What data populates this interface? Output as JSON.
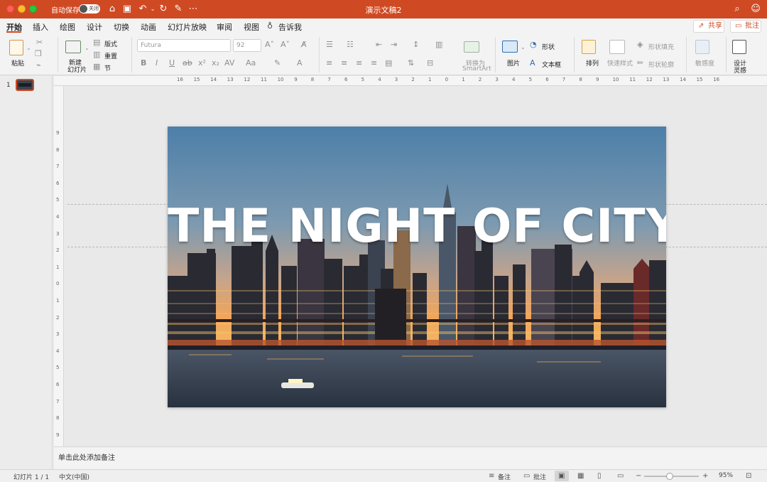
{
  "window": {
    "title": "演示文稿2",
    "autosave_label": "自动保存",
    "autosave_state": "关闭"
  },
  "tabs": [
    "开始",
    "插入",
    "绘图",
    "设计",
    "切换",
    "动画",
    "幻灯片放映",
    "审阅",
    "视图",
    "告诉我"
  ],
  "header_buttons": {
    "share": "共享",
    "comment": "批注"
  },
  "ribbon": {
    "paste": "粘贴",
    "new_slide_line1": "新建",
    "new_slide_line2": "幻灯片",
    "layout": "版式",
    "reset": "重置",
    "section": "节",
    "font_name": "Futura",
    "font_size": "92",
    "convert_smartart_line1": "转换为",
    "convert_smartart_line2": "SmartArt",
    "picture": "图片",
    "shape": "形状",
    "textbox": "文本框",
    "arrange": "排列",
    "quick_styles": "快速样式",
    "shape_fill": "形状填充",
    "shape_outline": "形状轮廓",
    "sensitivity": "敏感度",
    "designer_line1": "设计",
    "designer_line2": "灵感"
  },
  "thumbnail": {
    "number": "1"
  },
  "hruler_ticks": [
    "16",
    "15",
    "14",
    "13",
    "12",
    "11",
    "10",
    "9",
    "8",
    "7",
    "6",
    "5",
    "4",
    "3",
    "2",
    "1",
    "0",
    "1",
    "2",
    "3",
    "4",
    "5",
    "6",
    "7",
    "8",
    "9",
    "10",
    "11",
    "12",
    "13",
    "14",
    "15",
    "16"
  ],
  "vruler_ticks": [
    "9",
    "8",
    "7",
    "6",
    "5",
    "4",
    "3",
    "2",
    "1",
    "0",
    "1",
    "2",
    "3",
    "4",
    "5",
    "6",
    "7",
    "8",
    "9"
  ],
  "slide": {
    "title": "THE NIGHT OF CITY"
  },
  "notes": {
    "placeholder": "单击此处添加备注"
  },
  "status": {
    "slide_count": "幻灯片 1 / 1",
    "language": "中文(中国)",
    "notes_btn": "备注",
    "comments_btn": "批注",
    "zoom": "95%"
  },
  "colors": {
    "accent": "#cf4a23"
  }
}
